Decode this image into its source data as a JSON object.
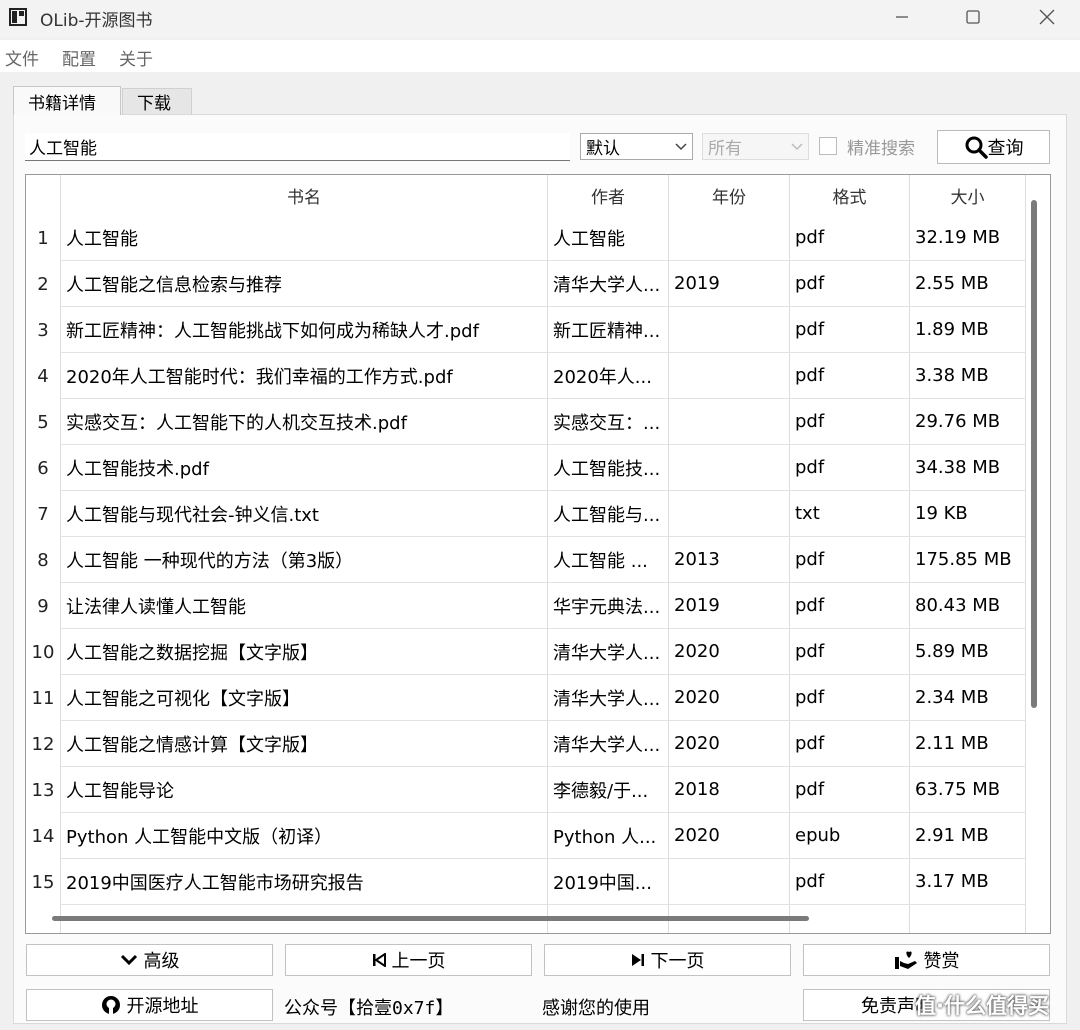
{
  "window": {
    "title": "OLib-开源图书"
  },
  "menu": [
    "文件",
    "配置",
    "关于"
  ],
  "tabs": [
    {
      "label": "书籍详情",
      "active": true
    },
    {
      "label": "下载",
      "active": false
    }
  ],
  "search": {
    "query": "人工智能",
    "sort_select": "默认",
    "scope_select": "所有",
    "exact_label": "精准搜索",
    "exact_checked": false,
    "button_label": "查询"
  },
  "table": {
    "columns": [
      "书名",
      "作者",
      "年份",
      "格式",
      "大小"
    ],
    "rows": [
      {
        "n": "1",
        "title": "人工智能",
        "author": "人工智能",
        "year": "",
        "format": "pdf",
        "size": "32.19 MB"
      },
      {
        "n": "2",
        "title": "人工智能之信息检索与推荐",
        "author": "清华大学人...",
        "year": "2019",
        "format": "pdf",
        "size": "2.55 MB"
      },
      {
        "n": "3",
        "title": "新工匠精神：人工智能挑战下如何成为稀缺人才.pdf",
        "author": "新工匠精神...",
        "year": "",
        "format": "pdf",
        "size": "1.89 MB"
      },
      {
        "n": "4",
        "title": "2020年人工智能时代：我们幸福的工作方式.pdf",
        "author": "2020年人...",
        "year": "",
        "format": "pdf",
        "size": "3.38 MB"
      },
      {
        "n": "5",
        "title": "实感交互：人工智能下的人机交互技术.pdf",
        "author": "实感交互：...",
        "year": "",
        "format": "pdf",
        "size": "29.76 MB"
      },
      {
        "n": "6",
        "title": "人工智能技术.pdf",
        "author": "人工智能技...",
        "year": "",
        "format": "pdf",
        "size": "34.38 MB"
      },
      {
        "n": "7",
        "title": "人工智能与现代社会-钟义信.txt",
        "author": "人工智能与...",
        "year": "",
        "format": "txt",
        "size": "19 KB"
      },
      {
        "n": "8",
        "title": "人工智能 一种现代的方法（第3版）",
        "author": "人工智能 ...",
        "year": "2013",
        "format": "pdf",
        "size": "175.85 MB"
      },
      {
        "n": "9",
        "title": "让法律人读懂人工智能",
        "author": "华宇元典法...",
        "year": "2019",
        "format": "pdf",
        "size": "80.43 MB"
      },
      {
        "n": "10",
        "title": "人工智能之数据挖掘【文字版】",
        "author": "清华大学人...",
        "year": "2020",
        "format": "pdf",
        "size": "5.89 MB"
      },
      {
        "n": "11",
        "title": "人工智能之可视化【文字版】",
        "author": "清华大学人...",
        "year": "2020",
        "format": "pdf",
        "size": "2.34 MB"
      },
      {
        "n": "12",
        "title": "人工智能之情感计算【文字版】",
        "author": "清华大学人...",
        "year": "2020",
        "format": "pdf",
        "size": "2.11 MB"
      },
      {
        "n": "13",
        "title": "人工智能导论",
        "author": "李德毅/于...",
        "year": "2018",
        "format": "pdf",
        "size": "63.75 MB"
      },
      {
        "n": "14",
        "title": "Python 人工智能中文版（初译）",
        "author": "Python 人...",
        "year": "2020",
        "format": "epub",
        "size": "2.91 MB"
      },
      {
        "n": "15",
        "title": "2019中国医疗人工智能市场研究报告",
        "author": "2019中国...",
        "year": "",
        "format": "pdf",
        "size": "3.17 MB"
      }
    ]
  },
  "buttons": {
    "advanced": "高级",
    "prev": "上一页",
    "next": "下一页",
    "donate": "赞赏",
    "source": "开源地址",
    "wechat": "公众号【拾壹0x7f】",
    "thanks": "感谢您的使用",
    "disclaimer": "免责声明",
    "watermark": "值·什么值得买"
  }
}
